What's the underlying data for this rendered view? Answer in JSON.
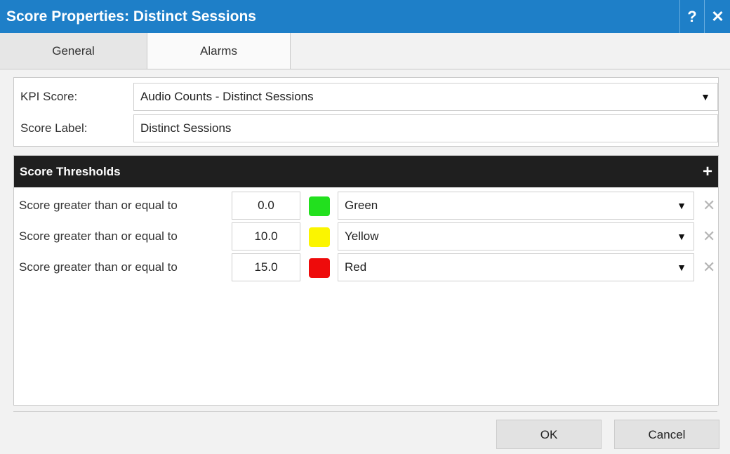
{
  "dialog": {
    "title": "Score Properties: Distinct Sessions",
    "help_label": "?",
    "close_label": "✕"
  },
  "tabs": [
    {
      "label": "General",
      "active": true
    },
    {
      "label": "Alarms",
      "active": false
    }
  ],
  "kpi": {
    "kpi_score_label": "KPI Score:",
    "kpi_score_value": "Audio Counts - Distinct Sessions",
    "score_label_label": "Score Label:",
    "score_label_value": "Distinct Sessions",
    "caret": "▼"
  },
  "thresholds": {
    "header": "Score Thresholds",
    "add_label": "+",
    "rows": [
      {
        "label": "Score greater than or equal to",
        "value": "0.0",
        "color": "#22e01e",
        "color_name": "Green",
        "caret": "▼",
        "delete": "✕"
      },
      {
        "label": "Score greater than or equal to",
        "value": "10.0",
        "color": "#fbf500",
        "color_name": "Yellow",
        "caret": "▼",
        "delete": "✕"
      },
      {
        "label": "Score greater than or equal to",
        "value": "15.0",
        "color": "#ee0b0b",
        "color_name": "Red",
        "caret": "▼",
        "delete": "✕"
      }
    ]
  },
  "footer": {
    "ok_label": "OK",
    "cancel_label": "Cancel"
  },
  "colors": {
    "titlebar": "#1e7fc8",
    "thresholds_header": "#1f1f1f"
  }
}
